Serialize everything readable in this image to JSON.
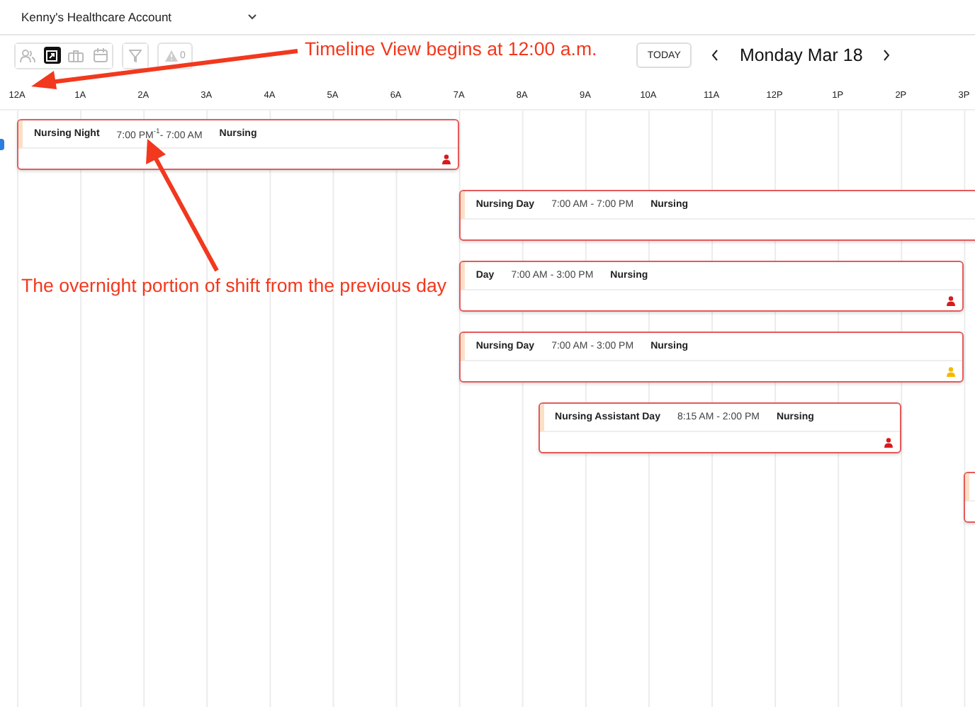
{
  "account": {
    "name": "Kenny's Healthcare Account"
  },
  "toolbar": {
    "view_buttons": [
      {
        "kind": "people",
        "selected": false
      },
      {
        "kind": "timeline",
        "selected": true
      },
      {
        "kind": "briefcase",
        "selected": false
      },
      {
        "kind": "calendar",
        "selected": false
      }
    ],
    "alert_count": "0",
    "today_label": "TODAY",
    "date_title": "Monday Mar 18"
  },
  "hours": [
    "12A",
    "1A",
    "2A",
    "3A",
    "4A",
    "5A",
    "6A",
    "7A",
    "8A",
    "9A",
    "10A",
    "11A",
    "12P",
    "1P",
    "2P",
    "3P"
  ],
  "shifts": [
    {
      "title": "Nursing Night",
      "time": "7:00 PM$^{-1}$- 7:00 AM",
      "role": "Nursing",
      "color": "#d81b1b"
    },
    {
      "title": "Nursing Day",
      "time": "7:00 AM - 7:00 PM",
      "role": "Nursing"
    },
    {
      "title": "Day",
      "time": "7:00 AM - 3:00 PM",
      "role": "Nursing",
      "color": "#d81b1b"
    },
    {
      "title": "Nursing Day",
      "time": "7:00 AM - 3:00 PM",
      "role": "Nursing",
      "color": "#f5b800"
    },
    {
      "title": "Nursing Assistant Day",
      "time": "8:15 AM - 2:00 PM",
      "role": "Nursing",
      "color": "#d81b1b"
    }
  ],
  "annotations": [
    {
      "text": "Timeline View begins at 12:00 a.m."
    },
    {
      "text": "The overnight portion of shift from the previous day"
    }
  ]
}
